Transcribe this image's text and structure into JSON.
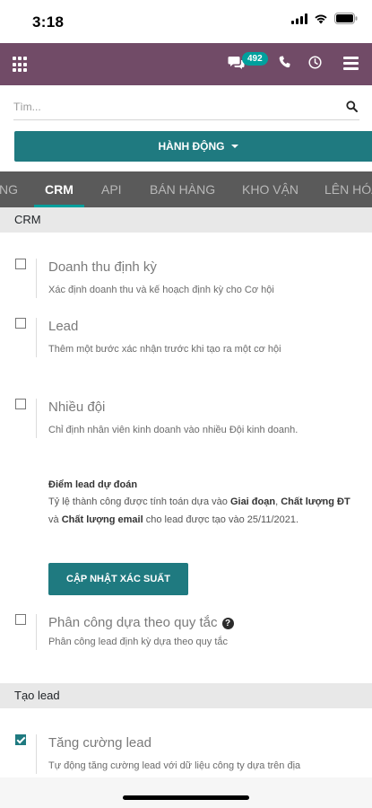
{
  "status_bar": {
    "time": "3:18"
  },
  "navbar": {
    "chat_count": "492"
  },
  "search": {
    "placeholder": "Tìm..."
  },
  "action": {
    "label": "HÀNH ĐỘNG"
  },
  "tabs": [
    "NG",
    "CRM",
    "API",
    "BÁN HÀNG",
    "KHO VẬN",
    "LÊN HÓA"
  ],
  "active_tab": "CRM",
  "sections": {
    "crm": {
      "header": "CRM"
    },
    "create_lead": {
      "header": "Tạo lead"
    }
  },
  "settings": [
    {
      "title": "Doanh thu định kỳ",
      "desc": "Xác định doanh thu và kế hoạch định kỳ cho Cơ hội",
      "checked": false
    },
    {
      "title": "Lead",
      "desc": "Thêm một bước xác nhận trước khi tạo ra một cơ hội",
      "checked": false
    },
    {
      "title": "Nhiều đội",
      "desc": "Chỉ định nhân viên kinh doanh vào nhiều Đội kinh doanh.",
      "checked": false
    },
    {
      "title": "Phân công dựa theo quy tắc",
      "desc": "Phân công lead định kỳ dựa theo quy tắc",
      "checked": false
    },
    {
      "title": "Tăng cường lead",
      "desc": "Tự động tăng cường lead với dữ liệu công ty dựa trên địa",
      "checked": true
    }
  ],
  "predictive": {
    "title": "Điểm lead dự đoán",
    "text_1": "Tỷ lệ thành công được tính toán dựa vào ",
    "bold_1": "Giai đoạn",
    "text_2": ", ",
    "bold_2": "Chất lượng ĐT",
    "text_3": " và ",
    "bold_3": "Chất lượng email",
    "text_4": " cho lead được tạo vào 25/11/2021.",
    "button": "CẬP NHẬT XÁC SUẤT"
  },
  "icons": {
    "apps": "apps-grid-icon",
    "chat": "chat-bubbles-icon",
    "phone": "phone-icon",
    "clock": "clock-icon",
    "menu": "hamburger-menu-icon",
    "search": "search-icon",
    "help": "question-circle-icon"
  },
  "colors": {
    "navbar": "#714b67",
    "primary": "#1f7a80",
    "badge": "#00a09d",
    "tabs_bg": "#5a5a5a"
  }
}
